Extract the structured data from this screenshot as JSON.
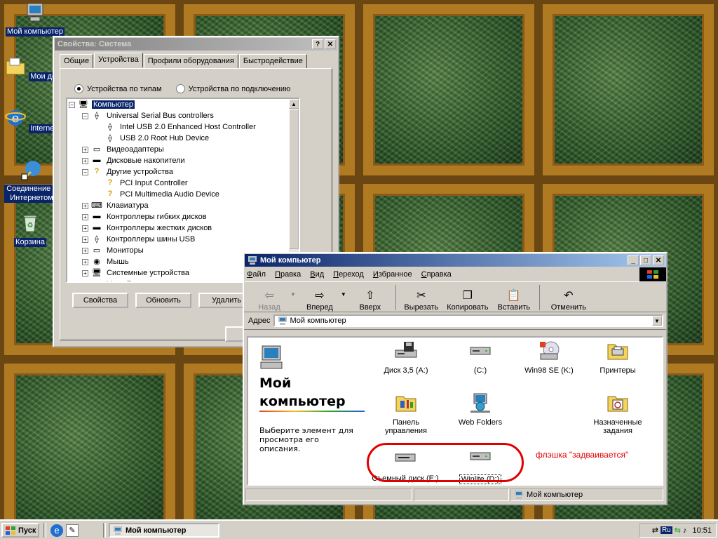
{
  "desktop": {
    "icons": [
      {
        "label": "Мой компьютер"
      },
      {
        "label": "Мои документы"
      },
      {
        "label": "Internet Explorer"
      },
      {
        "label": "Соединение с Интернетом"
      },
      {
        "label": "Корзина"
      }
    ]
  },
  "system_props": {
    "title": "Свойства: Система",
    "tabs": [
      "Общие",
      "Устройства",
      "Профили оборудования",
      "Быстродействие"
    ],
    "radio_by_type": "Устройства по типам",
    "radio_by_connection": "Устройства по подключению",
    "tree": [
      {
        "label": "Компьютер",
        "level": 0,
        "expander": "−",
        "icon": "computer-icon",
        "selected": true
      },
      {
        "label": "Universal Serial Bus controllers",
        "level": 1,
        "expander": "−",
        "icon": "usb-icon"
      },
      {
        "label": "Intel USB 2.0 Enhanced Host Controller",
        "level": 2,
        "expander": "",
        "icon": "usb-icon"
      },
      {
        "label": "USB 2.0 Root Hub Device",
        "level": 2,
        "expander": "",
        "icon": "usb-icon"
      },
      {
        "label": "Видеоадаптеры",
        "level": 1,
        "expander": "+",
        "icon": "monitor-icon"
      },
      {
        "label": "Дисковые накопители",
        "level": 1,
        "expander": "+",
        "icon": "disk-icon"
      },
      {
        "label": "Другие устройства",
        "level": 1,
        "expander": "−",
        "icon": "question-icon"
      },
      {
        "label": "PCI Input Controller",
        "level": 2,
        "expander": "",
        "icon": "question-icon"
      },
      {
        "label": "PCI Multimedia Audio Device",
        "level": 2,
        "expander": "",
        "icon": "question-icon"
      },
      {
        "label": "Клавиатура",
        "level": 1,
        "expander": "+",
        "icon": "keyboard-icon"
      },
      {
        "label": "Контроллеры гибких дисков",
        "level": 1,
        "expander": "+",
        "icon": "disk-icon"
      },
      {
        "label": "Контроллеры жестких дисков",
        "level": 1,
        "expander": "+",
        "icon": "disk-icon"
      },
      {
        "label": "Контроллеры шины USB",
        "level": 1,
        "expander": "+",
        "icon": "usb-icon"
      },
      {
        "label": "Мониторы",
        "level": 1,
        "expander": "+",
        "icon": "monitor-icon"
      },
      {
        "label": "Мышь",
        "level": 1,
        "expander": "+",
        "icon": "mouse-icon"
      },
      {
        "label": "Системные устройства",
        "level": 1,
        "expander": "+",
        "icon": "computer-icon"
      },
      {
        "label": "Устройства хранения",
        "level": 1,
        "expander": "+",
        "icon": "disk-icon"
      }
    ],
    "buttons": {
      "properties": "Свойства",
      "refresh": "Обновить",
      "remove": "Удалить"
    }
  },
  "explorer": {
    "title": "Мой компьютер",
    "menu": [
      "Файл",
      "Правка",
      "Вид",
      "Переход",
      "Избранное",
      "Справка"
    ],
    "toolbar": [
      "Назад",
      "Вперед",
      "Вверх",
      "Вырезать",
      "Копировать",
      "Вставить",
      "Отменить"
    ],
    "address_label": "Адрес",
    "address_value": "Мой компьютер",
    "pane_title": "Мой компьютер",
    "pane_desc": "Выберите элемент для просмотра его описания.",
    "items": [
      {
        "label": "Диск 3,5 (A:)",
        "icon": "floppy-drive-icon"
      },
      {
        "label": "(C:)",
        "icon": "hard-drive-icon"
      },
      {
        "label": "Win98 SE (K:)",
        "icon": "cd-drive-icon"
      },
      {
        "label": "Принтеры",
        "icon": "printers-folder-icon"
      },
      {
        "label": "Панель управления",
        "icon": "control-panel-icon"
      },
      {
        "label": "Web Folders",
        "icon": "web-folders-icon"
      },
      {
        "label": "Назначенные задания",
        "icon": "scheduled-tasks-icon"
      },
      {
        "label": "Съемный диск (E:)",
        "icon": "removable-disk-icon"
      },
      {
        "label": "Winlite (D:)",
        "icon": "hard-drive-icon"
      }
    ],
    "annotation": "флэшка \"задваивается\"",
    "annotation_color": "#e00000",
    "status_text": "Мой компьютер"
  },
  "taskbar": {
    "start": "Пуск",
    "task": "Мой компьютер",
    "lang": "Ru",
    "clock": "10:51"
  }
}
